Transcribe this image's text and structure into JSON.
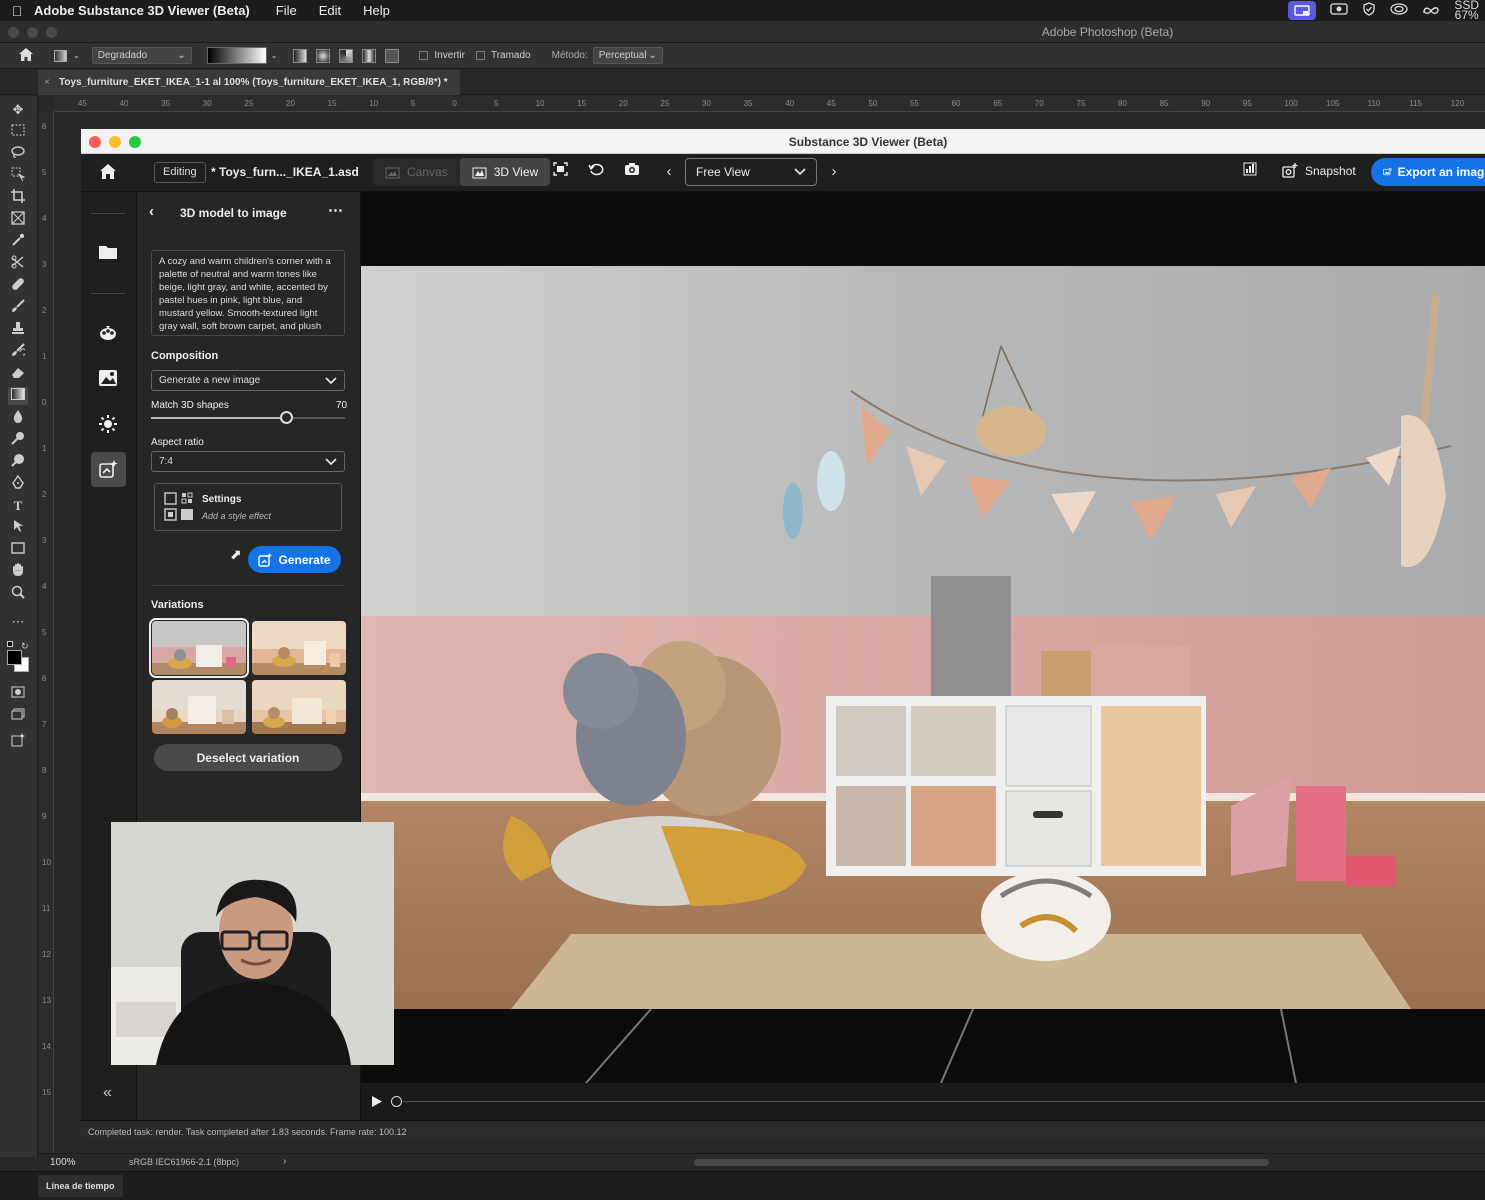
{
  "menubar": {
    "app_name": "Adobe Substance 3D Viewer (Beta)",
    "menus": [
      "File",
      "Edit",
      "Help"
    ],
    "ssd_label": "SSD",
    "ssd_value": "67%"
  },
  "photoshop": {
    "window_title": "Adobe Photoshop (Beta)",
    "options": {
      "gradient_mode": "Degradado",
      "invert_label": "Invertir",
      "dither_label": "Tramado",
      "method_label": "Método:",
      "method_value": "Perceptual"
    },
    "doc_tab": "Toys_furniture_EKET_IKEA_1-1 al 100% (Toys_furniture_EKET_IKEA_1, RGB/8*) *",
    "ruler_h_ticks": [
      "45",
      "40",
      "35",
      "30",
      "25",
      "20",
      "15",
      "10",
      "5",
      "0",
      "5",
      "10",
      "15",
      "20",
      "25",
      "30",
      "35",
      "40",
      "45",
      "50",
      "55",
      "60",
      "65",
      "70",
      "75",
      "80",
      "85",
      "90",
      "95",
      "100",
      "105",
      "110",
      "115",
      "120"
    ],
    "ruler_v_ticks": [
      "6",
      "5",
      "4",
      "3",
      "2",
      "1",
      "0",
      "1",
      "2",
      "3",
      "4",
      "5",
      "6",
      "7",
      "8",
      "9",
      "10",
      "11",
      "12",
      "13",
      "14",
      "15"
    ],
    "zoom": "100%",
    "color_profile": "sRGB IEC61966-2.1 (8bpc)",
    "timeline_tab": "Línea de tiempo"
  },
  "substance": {
    "window_title": "Substance 3D Viewer (Beta)",
    "editing_chip": "Editing",
    "doc_name": "* Toys_furn..._IKEA_1.asd",
    "canvas_label": "Canvas",
    "view3d_label": "3D View",
    "view_dropdown": "Free View",
    "snapshot_label": "Snapshot",
    "export_label": "Export an image",
    "status": "Completed task: render. Task completed after 1.83 seconds. Frame rate: 100.12"
  },
  "panel": {
    "title": "3D model to image",
    "prompt": "A cozy and warm children's corner with a palette of neutral and warm tones like beige, light gray, and white, accented by pastel hues in pink, light blue, and mustard yellow. Smooth-textured light gray wall, soft brown carpet, and plush",
    "composition_label": "Composition",
    "composition_value": "Generate a new image",
    "match_label": "Match 3D shapes",
    "match_value": "70",
    "match_fraction": 0.7,
    "aspect_label": "Aspect ratio",
    "aspect_value": "7:4",
    "settings_title": "Settings",
    "settings_sub": "Add a style effect",
    "generate_label": "Generate",
    "variations_label": "Variations",
    "deselect_label": "Deselect variation"
  },
  "colors": {
    "accent": "#1473e6",
    "menubar": "#1c1c1e",
    "panel": "#262626",
    "wall_top": "#b9bcbe",
    "wall_bottom": "#d9a9a2",
    "floor": "#a77b58"
  }
}
